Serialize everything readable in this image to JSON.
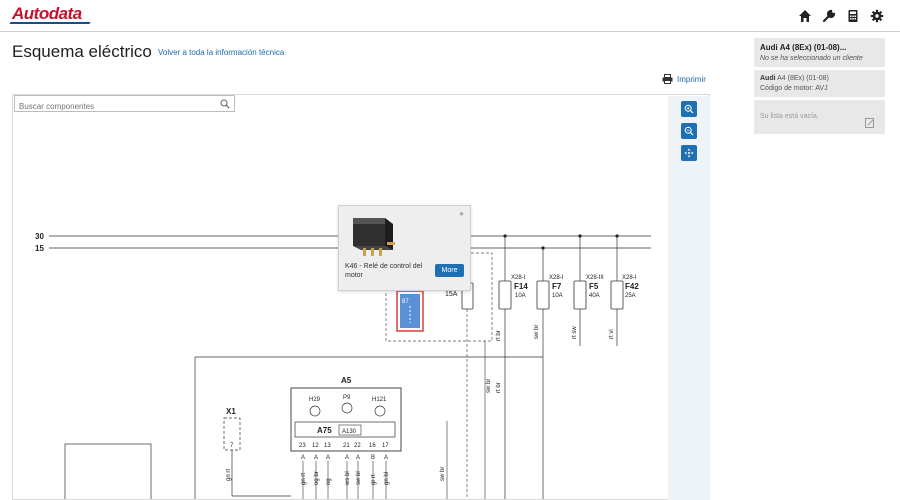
{
  "header": {
    "logo": "Autodata",
    "icons": [
      "home-icon",
      "wrench-icon",
      "calculator-icon",
      "settings-icon"
    ]
  },
  "page": {
    "title": "Esquema eléctrico",
    "back_link": "Volver a toda la información técnica",
    "print_label": "Imprimir"
  },
  "search": {
    "placeholder": "Buscar componentes"
  },
  "zoom": {
    "buttons": [
      "zoom-in-icon",
      "zoom-out-icon",
      "fit-icon"
    ]
  },
  "sidebar": {
    "vehicle_title": "Audi A4 (8Ex) (01-08)...",
    "no_client": "No se ha seleccionado un cliente",
    "make": "Audi",
    "model": "A4 (8Ex) (01-08)",
    "engine_code": "Código de motor: AVJ",
    "empty_list": "Su lista está vacía."
  },
  "popup": {
    "component": "K46 - Relé de control del motor",
    "more_label": "More"
  },
  "diagram": {
    "lines": [
      "30",
      "15"
    ],
    "relay_pin": "87",
    "fuses": [
      {
        "conn": "X28-I",
        "name": "F14",
        "rating": "10A"
      },
      {
        "conn": "X28-I",
        "name": "F7",
        "rating": "10A"
      },
      {
        "conn": "X28-III",
        "name": "F5",
        "rating": "40A"
      },
      {
        "conn": "X28-I",
        "name": "F42",
        "rating": "25A"
      }
    ],
    "partial_fuse_rating": "15A",
    "wire_labels": [
      "rt br",
      "sw br",
      "rt sw",
      "rt vi",
      "sw br",
      "rt br",
      "sw br"
    ],
    "module": {
      "name": "A5",
      "sub": "A75",
      "sub2": "A130",
      "indicators": [
        "H29",
        "P9",
        "H121"
      ],
      "pins": [
        "23",
        "12",
        "13",
        "21",
        "22",
        "16",
        "17"
      ],
      "pin_letters": [
        "A",
        "A",
        "A",
        "A",
        "A",
        "B",
        "A"
      ],
      "wires": [
        "gn rt",
        "og br",
        "og",
        "ws bl",
        "sw bl",
        "gr rt",
        "gn bl"
      ]
    },
    "connector": {
      "name": "X1",
      "pin": "7",
      "wire": "gn rt"
    }
  },
  "colors": {
    "accent": "#1f6fb5",
    "brand_red": "#c8102e",
    "relay_highlight": "#d9413a",
    "relay_fill": "#5b8fd6"
  }
}
